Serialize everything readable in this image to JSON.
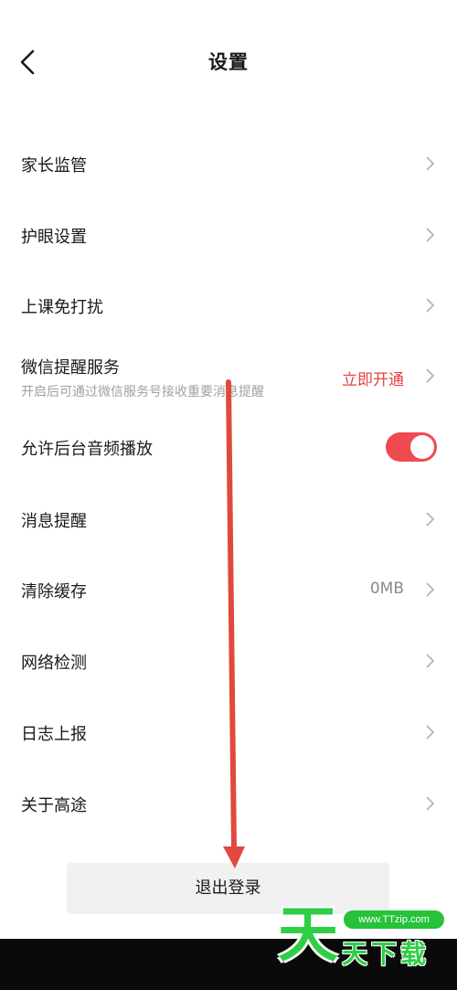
{
  "header": {
    "title": "设置",
    "back_icon": "chevron-left-icon"
  },
  "rows": [
    {
      "label": "家长监管"
    },
    {
      "label": "护眼设置"
    },
    {
      "label": "上课免打扰"
    },
    {
      "label": "微信提醒服务",
      "subtitle": "开启后可通过微信服务号接收重要消息提醒",
      "action": "立即开通"
    },
    {
      "label": "允许后台音频播放",
      "toggle_on": true
    },
    {
      "label": "消息提醒"
    },
    {
      "label": "清除缓存",
      "value": "0MB"
    },
    {
      "label": "网络检测"
    },
    {
      "label": "日志上报"
    },
    {
      "label": "关于高途"
    }
  ],
  "logout": {
    "label": "退出登录"
  },
  "watermark": {
    "big_char": "天",
    "small_text": "天下载",
    "url": "www.TTzip.com"
  },
  "colors": {
    "accent": "#e64340",
    "toggle": "#ee4a4f",
    "watermark": "#2ecf44",
    "annotation_arrow": "#e2483d"
  }
}
